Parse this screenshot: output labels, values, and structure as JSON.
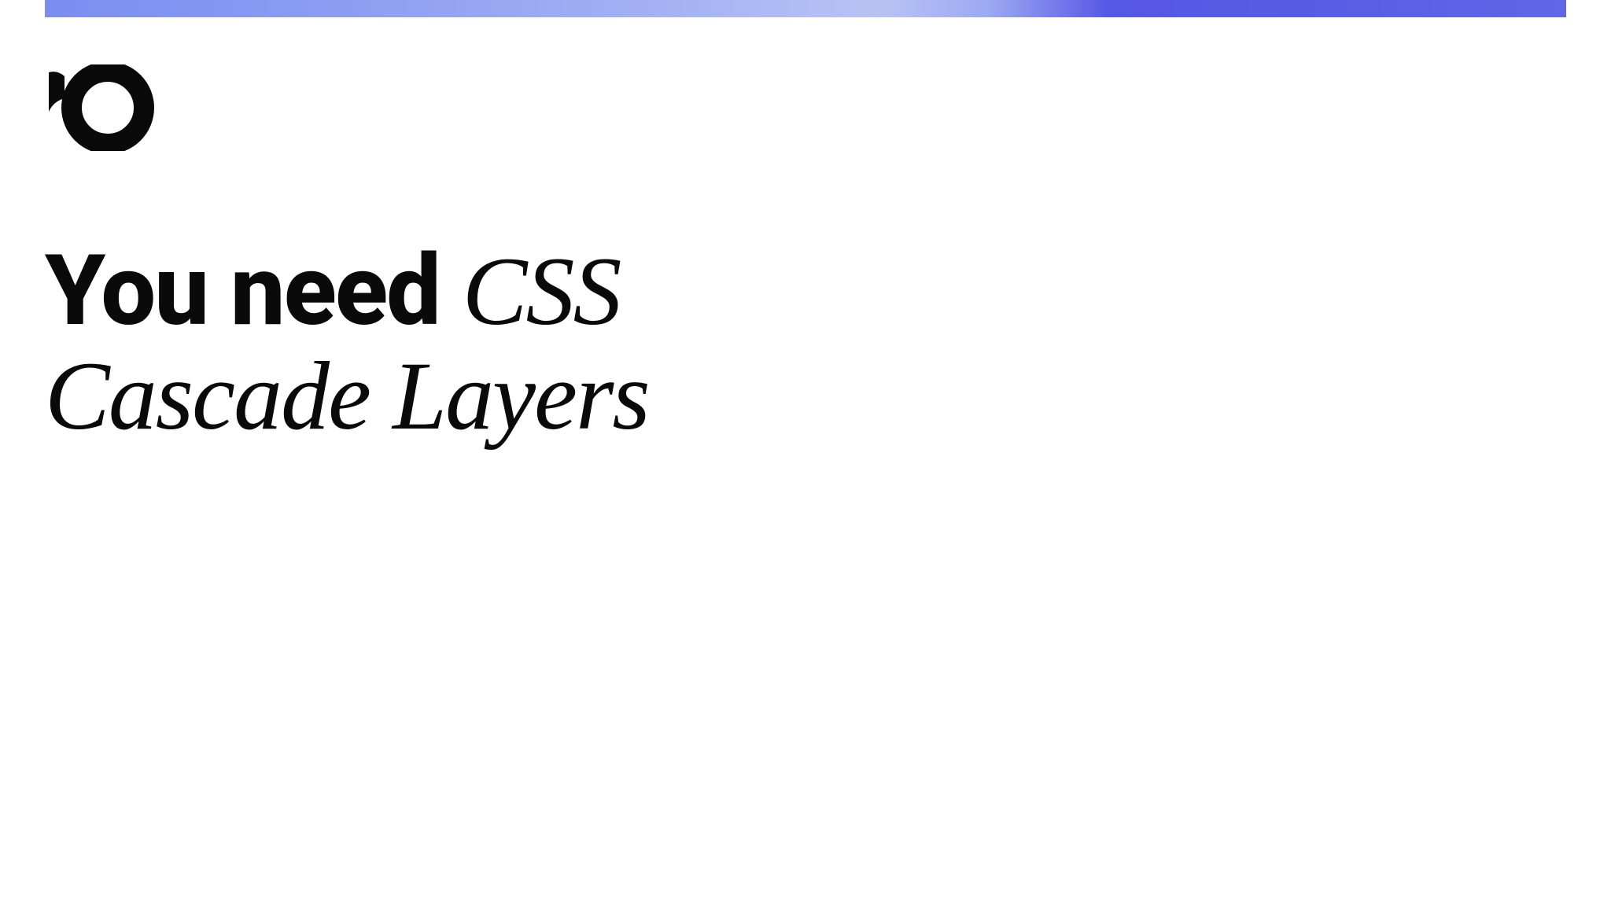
{
  "banner": {
    "gradient_start": "#7b8df0",
    "gradient_end": "#6166e6"
  },
  "logo": {
    "name": "io-logo"
  },
  "heading": {
    "prefix": "You need ",
    "italic_part1": "CSS",
    "italic_part2": "Cascade Layers"
  }
}
